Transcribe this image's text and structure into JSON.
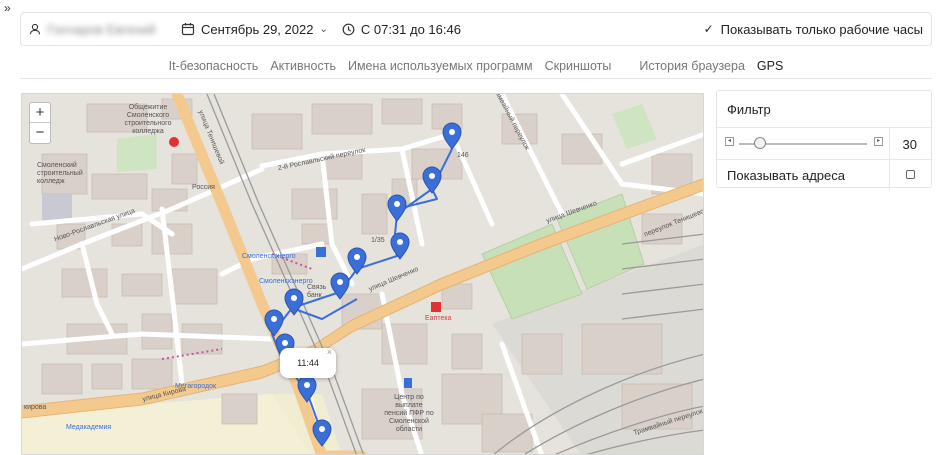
{
  "topbar": {
    "user_name": "Гончаров Евгений",
    "date": "Сентябрь 29, 2022",
    "time_range": "С 07:31 до 16:46",
    "work_hours_label": "Показывать только рабочие часы",
    "work_hours_checked": true
  },
  "tabs": [
    {
      "label": "It-безопасность",
      "active": false
    },
    {
      "label": "Активность",
      "active": false
    },
    {
      "label": "Имена используемых программ",
      "active": false
    },
    {
      "label": "Скриншоты",
      "active": false
    },
    {
      "label": "История браузера",
      "active": false
    },
    {
      "label": "GPS",
      "active": true
    }
  ],
  "map": {
    "zoom_in": "+",
    "zoom_out": "−",
    "popup_time": "11:44",
    "popup_close": "×",
    "labels": {
      "l1": "Общежитие Смоленского строительного колледжа",
      "l2": "Смоленский строительный колледж",
      "l3": "улица Тенишевой",
      "l4": "2-й Рославльский переулок",
      "l5": "Ново-Рославльская улица",
      "l6": "Смоленскэнерго",
      "l7": "Связь банк",
      "l8": "улица Шевченко",
      "l9": "Еаптека",
      "l10": "Центр по выплате пенсий ПФР по Смоленской области",
      "l11": "улица Кирова",
      "l12": "Медакадемия",
      "l13": "Мегагородок",
      "l14": "Россия",
      "l15": "Трамвайный переулок",
      "l16": "переулок Тенишевой",
      "l17": "кирова",
      "l18": "1/35",
      "l19": "146",
      "l20": "Трамвайный переулок"
    },
    "route_color": "#3b6fd8"
  },
  "filter": {
    "title": "Фильтр",
    "slider_value": 30,
    "slider_min": 0,
    "slider_max": 100,
    "addresses_label": "Показывать адреса",
    "addresses_checked": false
  }
}
